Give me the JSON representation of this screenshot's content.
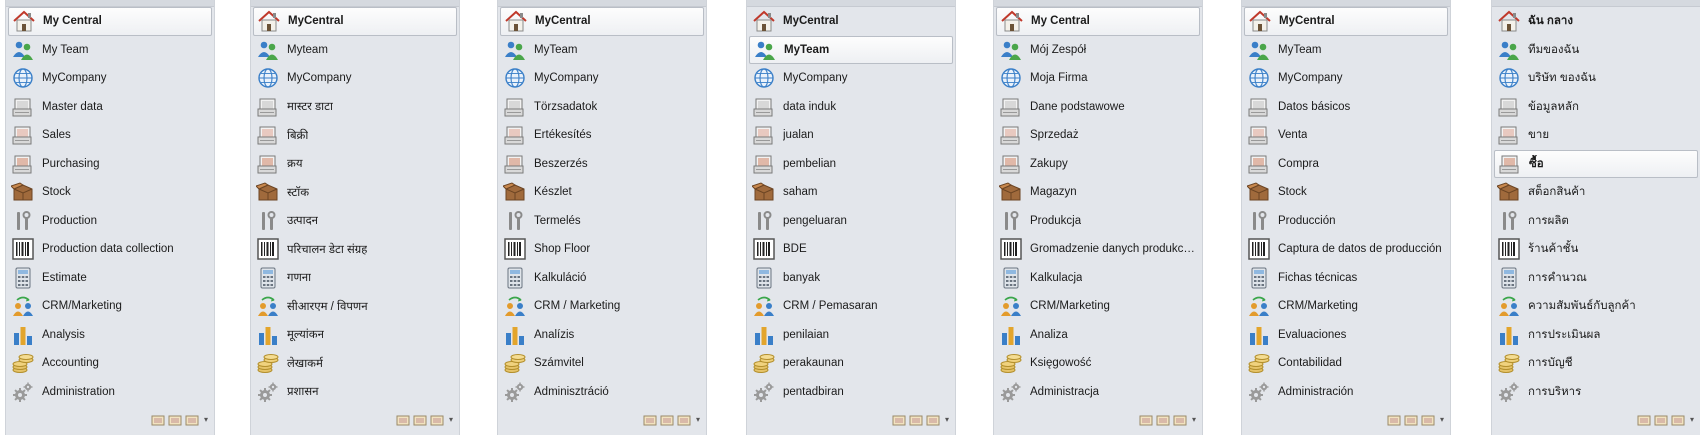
{
  "panels": [
    {
      "selected": 0,
      "labels": [
        "My Central",
        "My Team",
        "MyCompany",
        "Master data",
        "Sales",
        "Purchasing",
        "Stock",
        "Production",
        "Production data collection",
        "Estimate",
        "CRM/Marketing",
        "Analysis",
        "Accounting",
        "Administration"
      ]
    },
    {
      "selected": 0,
      "labels": [
        "MyCentral",
        "Myteam",
        "MyCompany",
        "मास्टर डाटा",
        "बिक्री",
        "क्रय",
        "स्टॉक",
        "उत्पादन",
        "परिचालन डेटा संग्रह",
        "गणना",
        "सीआरएम / विपणन",
        "मूल्यांकन",
        "लेखाकर्म",
        "प्रशासन"
      ]
    },
    {
      "selected": 0,
      "labels": [
        "MyCentral",
        "MyTeam",
        "MyCompany",
        "Törzsadatok",
        "Értékesítés",
        "Beszerzés",
        "Készlet",
        "Termelés",
        "Shop Floor",
        "Kalkuláció",
        "CRM / Marketing",
        "Analízis",
        "Számvitel",
        "Adminisztráció"
      ]
    },
    {
      "selected": 1,
      "labels": [
        "MyCentral",
        "MyTeam",
        "MyCompany",
        "data induk",
        "jualan",
        "pembelian",
        "saham",
        "pengeluaran",
        "BDE",
        "banyak",
        "CRM / Pemasaran",
        "penilaian",
        "perakaunan",
        "pentadbiran"
      ]
    },
    {
      "selected": 0,
      "labels": [
        "My Central",
        "Mój Zespół",
        "Moja Firma",
        "Dane podstawowe",
        "Sprzedaż",
        "Zakupy",
        "Magazyn",
        "Produkcja",
        "Gromadzenie danych produkcyjnych",
        "Kalkulacja",
        "CRM/Marketing",
        "Analiza",
        "Księgowość",
        "Administracja"
      ]
    },
    {
      "selected": 0,
      "labels": [
        "MyCentral",
        "MyTeam",
        "MyCompany",
        "Datos básicos",
        "Venta",
        "Compra",
        "Stock",
        "Producción",
        "Captura de datos de producción",
        "Fichas técnicas",
        "CRM/Marketing",
        "Evaluaciones",
        "Contabilidad",
        "Administración"
      ]
    },
    {
      "selected": 5,
      "labels": [
        "ฉัน กลาง",
        "ทีมของฉัน",
        "บริษัท ของฉัน",
        "ข้อมูลหลัก",
        "ขาย",
        "ซื้อ",
        "สต็อกสินค้า",
        "การผลิต",
        "ร้านค้าชั้น",
        "การคำนวณ",
        "ความสัมพันธ์กับลูกค้า",
        "การประเมินผล",
        "การบัญชี",
        "การบริหาร"
      ]
    }
  ],
  "icons": [
    "home-icon",
    "team-icon",
    "globe-icon",
    "master-data-icon",
    "sales-icon",
    "purchasing-icon",
    "stock-icon",
    "production-icon",
    "data-collection-icon",
    "calculator-icon",
    "crm-icon",
    "analysis-icon",
    "accounting-icon",
    "administration-icon"
  ],
  "footer_icons": [
    "mini-folder-icon",
    "mini-folder-icon",
    "mini-folder-icon"
  ],
  "footer_dropdown": "▾",
  "colors": {
    "panel_bg": "#e3e6eb",
    "selection_border": "#b9bec6",
    "text": "#1b1b1b"
  }
}
